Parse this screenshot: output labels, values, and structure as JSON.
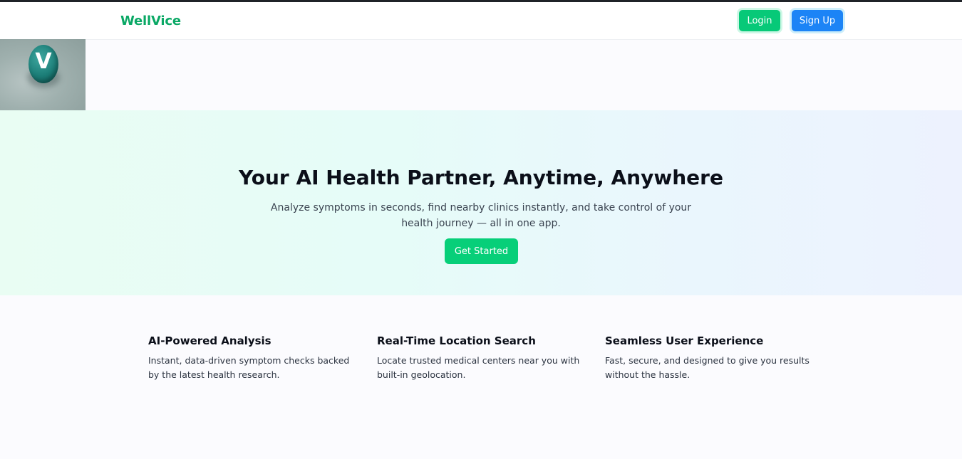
{
  "brand": {
    "name": "WellVice",
    "logo_letter": "V"
  },
  "nav": {
    "login_label": "Login",
    "signup_label": "Sign Up"
  },
  "hero": {
    "title": "Your AI Health Partner, Anytime, Anywhere",
    "subtitle": "Analyze symptoms in seconds, find nearby clinics instantly, and take control of your health journey — all in one app.",
    "cta_label": "Get Started"
  },
  "features": [
    {
      "title": "AI-Powered Analysis",
      "description": "Instant, data-driven symptom checks backed by the latest health research."
    },
    {
      "title": "Real-Time Location Search",
      "description": "Locate trusted medical centers near you with built-in geolocation."
    },
    {
      "title": "Seamless User Experience",
      "description": "Fast, secure, and designed to give you results without the hassle."
    }
  ],
  "colors": {
    "brand_green": "#0aa865",
    "login_button": "#07c978",
    "signup_button": "#1c84f6",
    "cta_button": "#07cf79"
  }
}
